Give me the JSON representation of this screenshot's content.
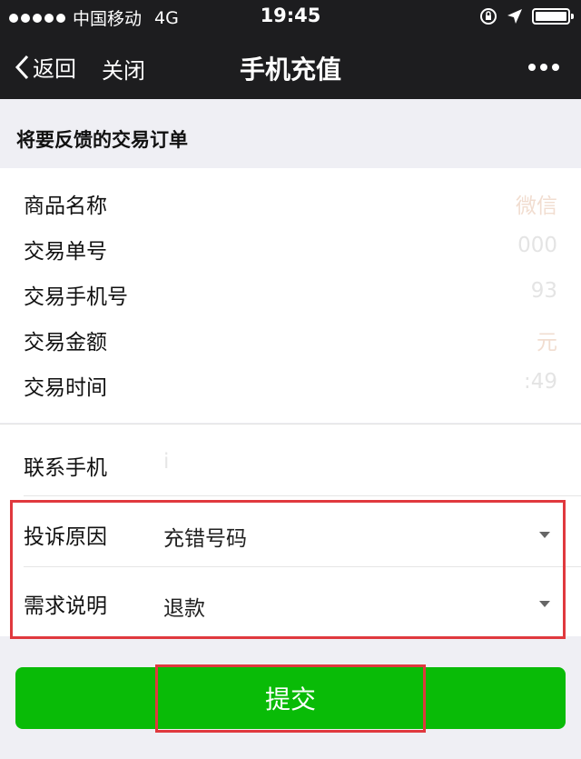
{
  "status": {
    "carrier": "中国移动",
    "network": "4G",
    "time": "19:45",
    "battery_level": 1.0
  },
  "nav": {
    "back_label": "返回",
    "close_label": "关闭",
    "title": "手机充值"
  },
  "section_title": "将要反馈的交易订单",
  "order": {
    "rows": [
      {
        "label": "商品名称",
        "value": "微信"
      },
      {
        "label": "交易单号",
        "value": "000"
      },
      {
        "label": "交易手机号",
        "value": "93"
      },
      {
        "label": "交易金额",
        "value": "元"
      },
      {
        "label": "交易时间",
        "value": ":49"
      }
    ]
  },
  "form": {
    "contact_label": "联系手机",
    "contact_value": "i",
    "reason_label": "投诉原因",
    "reason_value": "充错号码",
    "request_label": "需求说明",
    "request_value": "退款"
  },
  "submit_label": "提交",
  "colors": {
    "nav_bg": "#1d1d1f",
    "button_green": "#09bb07",
    "highlight_red": "#e0393e"
  }
}
